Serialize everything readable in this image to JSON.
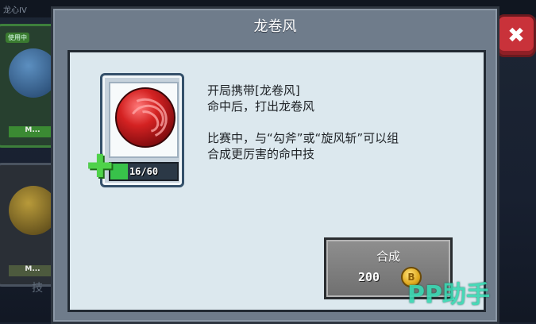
{
  "background": {
    "top_label": "龙心IV",
    "card1_tag": "使用中",
    "card1_label": "M...",
    "card2_label": "M...",
    "bottom_label": "技"
  },
  "dialog": {
    "title": "龙卷风",
    "close_icon": "close-icon"
  },
  "item": {
    "icon": "tornado-orb",
    "progress_text": "16/60",
    "progress_current": 16,
    "progress_max": 60,
    "plus_icon": "plus-icon"
  },
  "description": {
    "line1": "开局携带[龙卷风]",
    "line2": "命中后，打出龙卷风",
    "line3": "比赛中，与“勾斧”或“旋风斩”可以组",
    "line4": "合成更厉害的命中技"
  },
  "craft": {
    "label": "合成",
    "cost": "200",
    "currency_icon": "coin-icon"
  },
  "watermark": "PP助手",
  "colors": {
    "panel_bg": "#dce8ee",
    "close_red": "#c9323a",
    "progress_green": "#38c24a",
    "orb_red": "#d42222"
  }
}
